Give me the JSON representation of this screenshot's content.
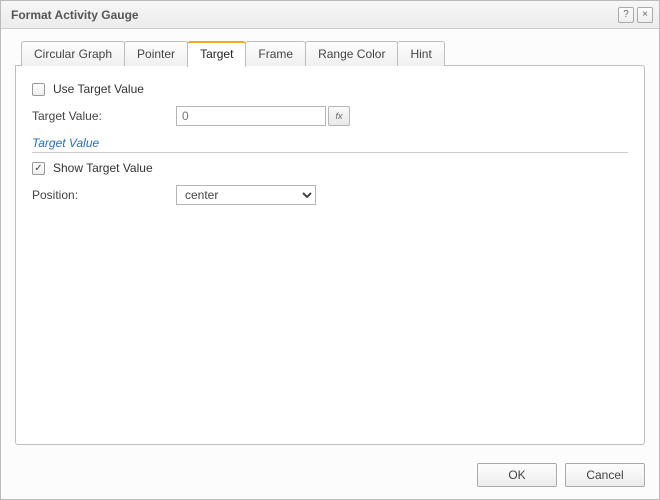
{
  "titlebar": {
    "title": "Format Activity Gauge",
    "help_label": "?",
    "close_label": "×"
  },
  "tabs": [
    {
      "label": "Circular Graph",
      "active": false
    },
    {
      "label": "Pointer",
      "active": false
    },
    {
      "label": "Target",
      "active": true
    },
    {
      "label": "Frame",
      "active": false
    },
    {
      "label": "Range Color",
      "active": false
    },
    {
      "label": "Hint",
      "active": false
    }
  ],
  "panel": {
    "use_target": {
      "label": "Use Target Value",
      "checked": false
    },
    "target_value": {
      "label": "Target Value:",
      "placeholder": "0",
      "fx_label": "fx"
    },
    "section": "Target Value",
    "show_target": {
      "label": "Show Target Value",
      "checked": true
    },
    "position": {
      "label": "Position:",
      "value": "center"
    }
  },
  "buttons": {
    "ok": "OK",
    "cancel": "Cancel"
  }
}
